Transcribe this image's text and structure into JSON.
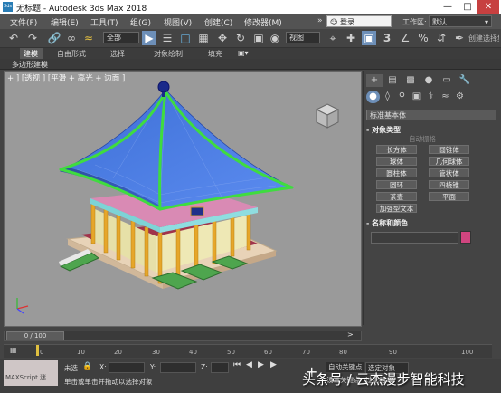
{
  "window": {
    "title": "无标题 - Autodesk 3ds Max 2018",
    "logo": "3ds"
  },
  "menu": [
    "文件(F)",
    "编辑(E)",
    "工具(T)",
    "组(G)",
    "视图(V)",
    "创建(C)",
    "修改器(M)"
  ],
  "signin": {
    "label": "登录",
    "placeholder": "登录"
  },
  "workspace": {
    "label": "工作区:",
    "value": "默认"
  },
  "toolbar": {
    "selection_filter": "全部",
    "ref_coord": "视图",
    "named_selection": "创建选择集"
  },
  "ribbon": {
    "tabs": [
      "建模",
      "自由形式",
      "选择",
      "对象绘制",
      "填充"
    ],
    "active": "建模",
    "sub_label": "多边形建模"
  },
  "viewport": {
    "label": "+ ] [透视 ] [平滑 + 高光 + 边面 ]"
  },
  "command_panel": {
    "category": "标准基本体",
    "object_type_header": "对象类型",
    "autogrid": "自动栅格",
    "buttons": [
      "长方体",
      "圆锥体",
      "球体",
      "几何球体",
      "圆柱体",
      "管状体",
      "圆环",
      "四棱锥",
      "茶壶",
      "平面",
      "加强型文本"
    ],
    "name_color_header": "名称和颜色",
    "color": "#d0457f"
  },
  "timeline": {
    "frame": "0 / 100",
    "ticks": [
      "0",
      "10",
      "20",
      "30",
      "40",
      "50",
      "60",
      "70",
      "80",
      "90",
      "100"
    ]
  },
  "status": {
    "maxscript": "MAXScript 迷",
    "selection": "未选",
    "prompt": "单击或单击并拖动以选择对象",
    "x_label": "X:",
    "y_label": "Y:",
    "z_label": "Z:",
    "autokey": "自动关键点",
    "selected": "选定对象",
    "set_key": "设置关键点",
    "filters": "过滤器..."
  },
  "watermark": "头条号 / 云杰漫步智能科技"
}
